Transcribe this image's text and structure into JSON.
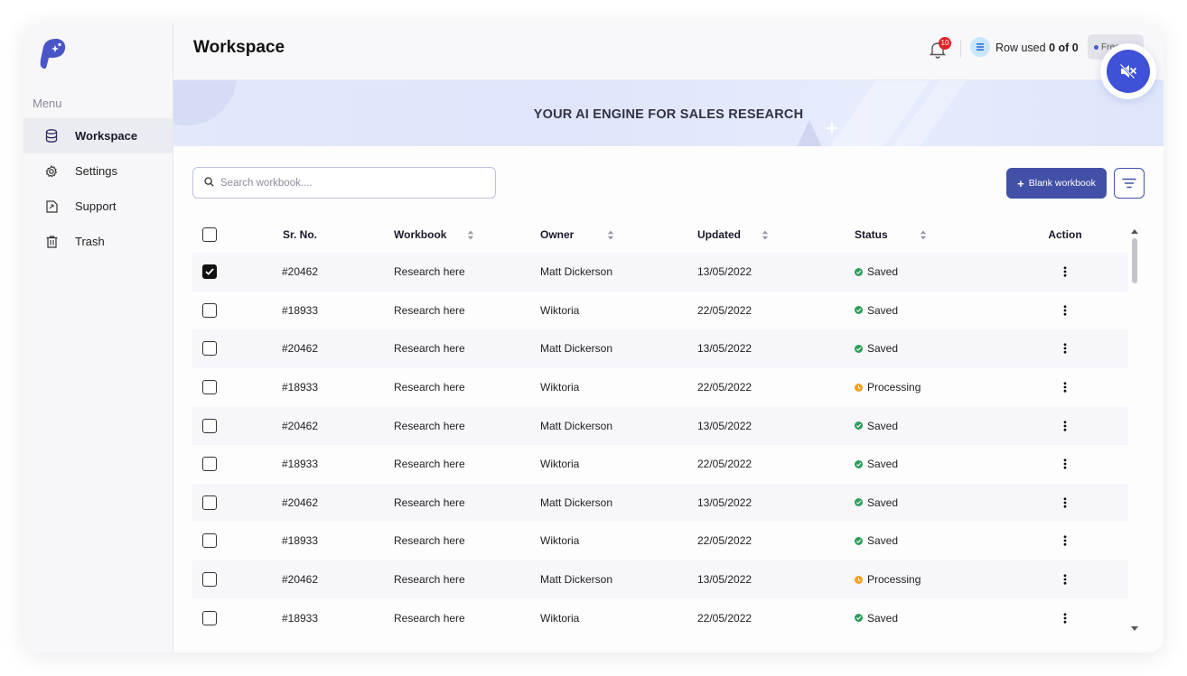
{
  "app": {
    "page_title": "Workspace"
  },
  "sidebar": {
    "menu_label": "Menu",
    "items": [
      {
        "label": "Workspace",
        "icon": "database-icon",
        "active": true
      },
      {
        "label": "Settings",
        "icon": "gear-icon",
        "active": false
      },
      {
        "label": "Support",
        "icon": "support-doc-icon",
        "active": false
      },
      {
        "label": "Trash",
        "icon": "trash-icon",
        "active": false
      }
    ]
  },
  "header": {
    "notification_count": "10",
    "rows_used_label": "Row used",
    "rows_used_value": "0 of 0",
    "plan_label": "Free"
  },
  "banner": {
    "title": "YOUR AI ENGINE FOR SALES RESEARCH"
  },
  "toolbar": {
    "search_placeholder": "Search workbook....",
    "blank_workbook_label": "Blank workbook"
  },
  "table": {
    "headers": {
      "sr_no": "Sr. No.",
      "workbook": "Workbook",
      "owner": "Owner",
      "updated": "Updated",
      "status": "Status",
      "action": "Action"
    },
    "rows": [
      {
        "checked": true,
        "sr": "#20462",
        "workbook": "Research here",
        "owner": "Matt Dickerson",
        "updated": "13/05/2022",
        "status": "Saved"
      },
      {
        "checked": false,
        "sr": "#18933",
        "workbook": "Research here",
        "owner": "Wiktoria",
        "updated": "22/05/2022",
        "status": "Saved"
      },
      {
        "checked": false,
        "sr": "#20462",
        "workbook": "Research here",
        "owner": "Matt Dickerson",
        "updated": "13/05/2022",
        "status": "Saved"
      },
      {
        "checked": false,
        "sr": "#18933",
        "workbook": "Research here",
        "owner": "Wiktoria",
        "updated": "22/05/2022",
        "status": "Processing"
      },
      {
        "checked": false,
        "sr": "#20462",
        "workbook": "Research here",
        "owner": "Matt Dickerson",
        "updated": "13/05/2022",
        "status": "Saved"
      },
      {
        "checked": false,
        "sr": "#18933",
        "workbook": "Research here",
        "owner": "Wiktoria",
        "updated": "22/05/2022",
        "status": "Saved"
      },
      {
        "checked": false,
        "sr": "#20462",
        "workbook": "Research here",
        "owner": "Matt Dickerson",
        "updated": "13/05/2022",
        "status": "Saved"
      },
      {
        "checked": false,
        "sr": "#18933",
        "workbook": "Research here",
        "owner": "Wiktoria",
        "updated": "22/05/2022",
        "status": "Saved"
      },
      {
        "checked": false,
        "sr": "#20462",
        "workbook": "Research here",
        "owner": "Matt Dickerson",
        "updated": "13/05/2022",
        "status": "Processing"
      },
      {
        "checked": false,
        "sr": "#18933",
        "workbook": "Research here",
        "owner": "Wiktoria",
        "updated": "22/05/2022",
        "status": "Saved"
      }
    ]
  },
  "colors": {
    "accent": "#4350a8",
    "saved": "#2e9e5b",
    "processing": "#f2a024",
    "badge": "#e02424",
    "mute_button": "#3f51d6"
  }
}
